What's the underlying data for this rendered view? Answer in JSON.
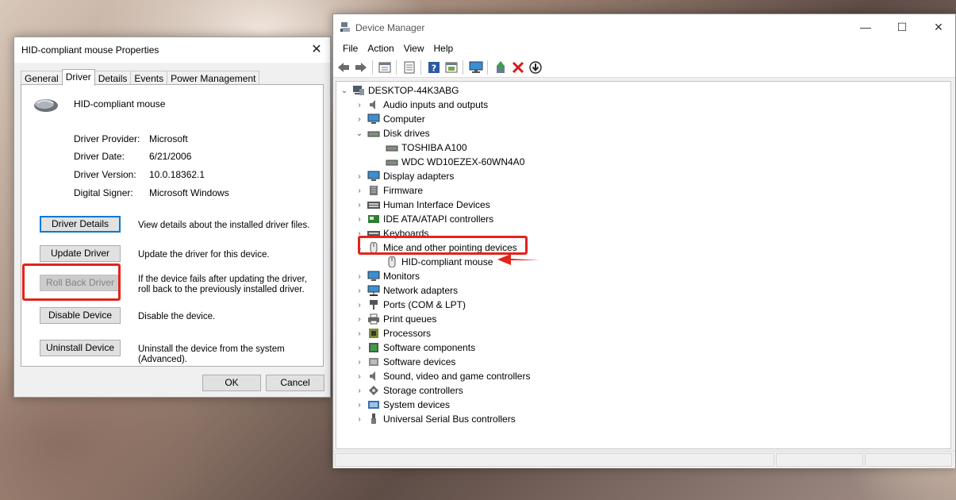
{
  "properties_dialog": {
    "title": "HID-compliant mouse Properties",
    "close_glyph": "✕",
    "tabs": [
      "General",
      "Driver",
      "Details",
      "Events",
      "Power Management"
    ],
    "active_tab": "Driver",
    "device_name": "HID-compliant mouse",
    "info": [
      {
        "label": "Driver Provider:",
        "value": "Microsoft"
      },
      {
        "label": "Driver Date:",
        "value": "6/21/2006"
      },
      {
        "label": "Driver Version:",
        "value": "10.0.18362.1"
      },
      {
        "label": "Digital Signer:",
        "value": "Microsoft Windows"
      }
    ],
    "actions": [
      {
        "button": "Driver Details",
        "desc": "View details about the installed driver files."
      },
      {
        "button": "Update Driver",
        "desc": "Update the driver for this device."
      },
      {
        "button": "Roll Back Driver",
        "desc": "If the device fails after updating the driver, roll back to the previously installed driver."
      },
      {
        "button": "Disable Device",
        "desc": "Disable the device."
      },
      {
        "button": "Uninstall Device",
        "desc": "Uninstall the device from the system (Advanced)."
      }
    ],
    "ok_label": "OK",
    "cancel_label": "Cancel"
  },
  "device_manager": {
    "title": "Device Manager",
    "caption": {
      "minimize": "—",
      "maximize": "☐",
      "close": "✕"
    },
    "menu": [
      "File",
      "Action",
      "View",
      "Help"
    ],
    "toolbar_icons": [
      "back-icon",
      "forward-icon",
      "show-hide-icon",
      "properties-icon",
      "help-icon",
      "driver-icon",
      "computer-icon",
      "update-driver-icon",
      "uninstall-icon",
      "scan-changes-icon"
    ],
    "tree": {
      "root": "DESKTOP-44K3ABG",
      "items": [
        {
          "label": "Audio inputs and outputs",
          "expanded": false
        },
        {
          "label": "Computer",
          "expanded": false
        },
        {
          "label": "Disk drives",
          "expanded": true,
          "children": [
            "TOSHIBA A100",
            "WDC WD10EZEX-60WN4A0"
          ]
        },
        {
          "label": "Display adapters",
          "expanded": false
        },
        {
          "label": "Firmware",
          "expanded": false
        },
        {
          "label": "Human Interface Devices",
          "expanded": false
        },
        {
          "label": "IDE ATA/ATAPI controllers",
          "expanded": false
        },
        {
          "label": "Keyboards",
          "expanded": false
        },
        {
          "label": "Mice and other pointing devices",
          "expanded": true,
          "children": [
            "HID-compliant mouse"
          ]
        },
        {
          "label": "Monitors",
          "expanded": false
        },
        {
          "label": "Network adapters",
          "expanded": false
        },
        {
          "label": "Ports (COM & LPT)",
          "expanded": false
        },
        {
          "label": "Print queues",
          "expanded": false
        },
        {
          "label": "Processors",
          "expanded": false
        },
        {
          "label": "Software components",
          "expanded": false
        },
        {
          "label": "Software devices",
          "expanded": false
        },
        {
          "label": "Sound, video and game controllers",
          "expanded": false
        },
        {
          "label": "Storage controllers",
          "expanded": false
        },
        {
          "label": "System devices",
          "expanded": false
        },
        {
          "label": "Universal Serial Bus controllers",
          "expanded": false
        }
      ]
    }
  },
  "colors": {
    "highlight_red": "#e3241b",
    "focus_blue": "#0078d7"
  }
}
